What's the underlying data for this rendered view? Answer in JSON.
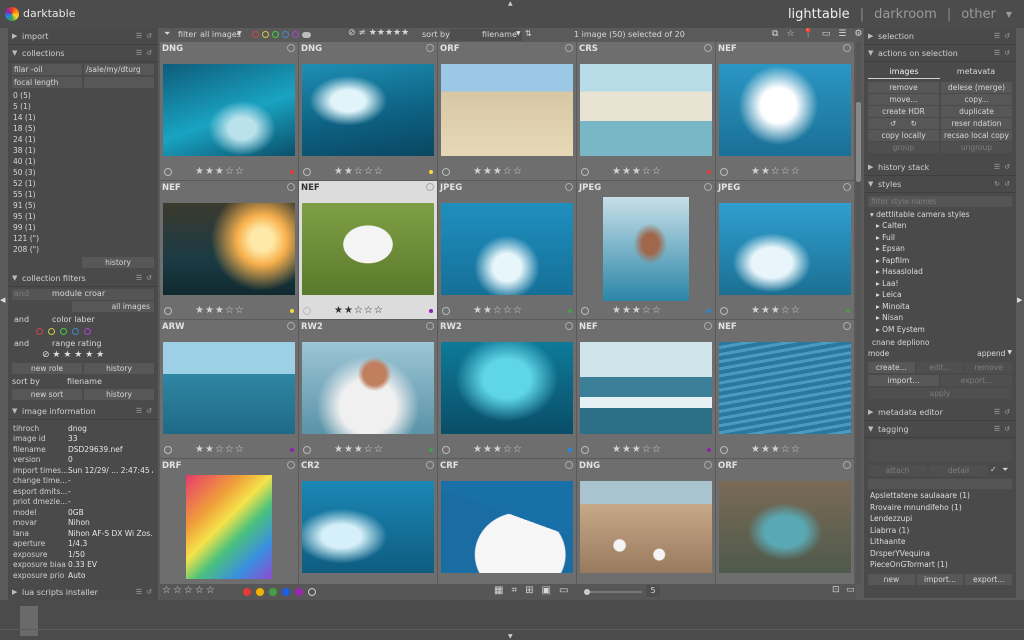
{
  "app": {
    "name": "darktable"
  },
  "views": {
    "lighttable": "lighttable",
    "darkroom": "darkroom",
    "other": "other",
    "sep": "|"
  },
  "left": {
    "import": "import",
    "collections": "collections",
    "filter_label": "filar -oil",
    "filter_path": "/sale/my/dturg",
    "focal_label": "focal length",
    "focal_values": [
      "0 (5)",
      "5 (1)",
      "14 (1)",
      "18 (5)",
      "24 (1)",
      "38 (1)",
      "40 (1)",
      "50 (3)",
      "52 (1)",
      "55 (1)",
      "91 (5)",
      "95 (1)",
      "99 (1)",
      "121 (\")",
      "208 (\")"
    ],
    "history_btn": "history",
    "collection_filters": "collection filters",
    "filters": [
      {
        "op": "and",
        "name": "module croar",
        "value": "all images"
      },
      {
        "op": "and",
        "name": "color laber",
        "value": ""
      },
      {
        "op": "and",
        "name": "range rating",
        "value": ""
      }
    ],
    "new_role": "new role",
    "history2": "history",
    "sort_by": "sort by",
    "sort_value": "filename",
    "new_sort": "new sort",
    "history3": "history",
    "image_info": "image information",
    "info": [
      {
        "k": "tihroch",
        "v": "dnog"
      },
      {
        "k": "image id",
        "v": "33"
      },
      {
        "k": "filename",
        "v": "DSD29639.nef"
      },
      {
        "k": "version",
        "v": "0"
      },
      {
        "k": "import times...",
        "v": "Sun 12/29/ ... 2:47:45 AM"
      },
      {
        "k": "change time...",
        "v": "-"
      },
      {
        "k": "esport dmits...",
        "v": "-"
      },
      {
        "k": "priot dmezie...",
        "v": "-"
      },
      {
        "k": "model",
        "v": "0GB"
      },
      {
        "k": "movar",
        "v": "Nihon"
      },
      {
        "k": "lana",
        "v": "Nihon AF-S DX Wi Zos..."
      },
      {
        "k": "aperture",
        "v": "1/4.3"
      },
      {
        "k": "exposure",
        "v": "1/50"
      },
      {
        "k": "exposure biaa",
        "v": "0.33 EV"
      },
      {
        "k": "exposure prio",
        "v": "Auto"
      }
    ],
    "lua": "lua scripts installer"
  },
  "toolbar": {
    "filter": "filter",
    "filter_value": "all images",
    "sort_by": "sort by",
    "sort_value": "filename",
    "status": "1 image (50) selected of 20"
  },
  "thumbs": [
    {
      "ext": "DNG",
      "stars": 3,
      "label": "#e53935"
    },
    {
      "ext": "DNG",
      "stars": 2,
      "label": "#fdd835"
    },
    {
      "ext": "ORF",
      "stars": 3,
      "label": ""
    },
    {
      "ext": "CRS",
      "stars": 3,
      "label": "#e53935"
    },
    {
      "ext": "NEF",
      "stars": 2,
      "label": ""
    },
    {
      "ext": "NEF",
      "stars": 3,
      "label": "#fdd835"
    },
    {
      "ext": "NEF",
      "stars": 2,
      "label": "#8e24aa"
    },
    {
      "ext": "JPEG",
      "stars": 2,
      "label": "#43a047"
    },
    {
      "ext": "JPEG",
      "stars": 3,
      "label": "#1e88e5"
    },
    {
      "ext": "JPEG",
      "stars": 3,
      "label": "#43a047"
    },
    {
      "ext": "ARW",
      "stars": 2,
      "label": "#8e24aa"
    },
    {
      "ext": "RW2",
      "stars": 3,
      "label": "#43a047"
    },
    {
      "ext": "RW2",
      "stars": 3,
      "label": "#1e88e5"
    },
    {
      "ext": "NEF",
      "stars": 3,
      "label": "#8e24aa"
    },
    {
      "ext": "NEF",
      "stars": 3,
      "label": ""
    },
    {
      "ext": "DRF",
      "stars": 0,
      "label": ""
    },
    {
      "ext": "CR2",
      "stars": 0,
      "label": ""
    },
    {
      "ext": "CRF",
      "stars": 0,
      "label": ""
    },
    {
      "ext": "DNG",
      "stars": 0,
      "label": ""
    },
    {
      "ext": "ORF",
      "stars": 0,
      "label": ""
    }
  ],
  "bottom": {
    "zoom": "5"
  },
  "right": {
    "selection": "selection",
    "actions": "actions on selection",
    "tab_images": "images",
    "tab_metadata": "metavata",
    "buttons": [
      "remove",
      "delese (merge)",
      "move...",
      "copy...",
      "create HDR",
      "duplicate",
      "",
      "reser ndation",
      "copy locally",
      "recsao local copy",
      "group",
      "ungroup"
    ],
    "history_stack": "history stack",
    "styles": "styles",
    "styles_search": "filter style names",
    "styles_group": "dettlitable camera styles",
    "style_items": [
      "Calten",
      "Fuil",
      "Epsan",
      "Fapfilm",
      "Hasaslolad",
      "Laa!",
      "Leica",
      "Minoita",
      "Nisan",
      "OM Eystem"
    ],
    "create_dup": "cnane depliono",
    "mode": "mode",
    "mode_value": "append",
    "create": "create...",
    "edit": "edit...",
    "remove": "remove",
    "import": "import...",
    "export": "export...",
    "apply": "apply",
    "metadata": "metadata editor",
    "tagging": "tagging",
    "attach": "attach",
    "detach": "detail",
    "tags": [
      "Apslettatene saulaaare (1)",
      "Rrovaire mnundifeho (1)",
      "Lendezzupi",
      "Liabrra (1)",
      "Lithaante",
      "DrsperYVequina",
      "PieceOnGTormart (1)"
    ],
    "new": "new",
    "import2": "import...",
    "export2": "export..."
  }
}
